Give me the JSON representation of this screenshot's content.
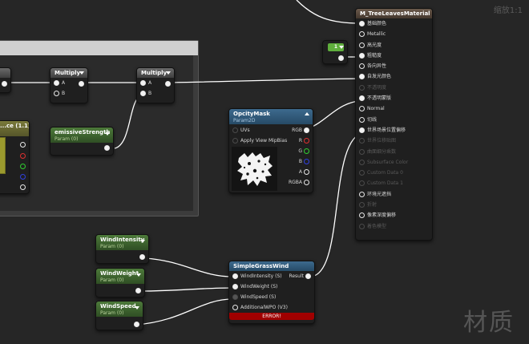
{
  "zoom_label": "缩放1:1",
  "watermark": "材质",
  "material_node": {
    "title": "M_TreeLeavesMaterial",
    "pins": [
      {
        "label": "基础颜色",
        "connected": true,
        "enabled": true
      },
      {
        "label": "Metallic",
        "connected": false,
        "enabled": true
      },
      {
        "label": "高光度",
        "connected": false,
        "enabled": true
      },
      {
        "label": "粗糙度",
        "connected": true,
        "enabled": true
      },
      {
        "label": "各向异性",
        "connected": false,
        "enabled": true
      },
      {
        "label": "自发光颜色",
        "connected": true,
        "enabled": true
      },
      {
        "label": "不透明度",
        "connected": false,
        "enabled": false
      },
      {
        "label": "不透明蒙版",
        "connected": true,
        "enabled": true
      },
      {
        "label": "Normal",
        "connected": false,
        "enabled": true
      },
      {
        "label": "切线",
        "connected": false,
        "enabled": true
      },
      {
        "label": "世界场景位置偏移",
        "connected": true,
        "enabled": true
      },
      {
        "label": "世界位移贴图",
        "connected": false,
        "enabled": false
      },
      {
        "label": "曲面细分乘数",
        "connected": false,
        "enabled": false
      },
      {
        "label": "Subsurface Color",
        "connected": false,
        "enabled": false
      },
      {
        "label": "Custom Data 0",
        "connected": false,
        "enabled": false
      },
      {
        "label": "Custom Data 1",
        "connected": false,
        "enabled": false
      },
      {
        "label": "环境光遮挡",
        "connected": false,
        "enabled": true
      },
      {
        "label": "折射",
        "connected": false,
        "enabled": false
      },
      {
        "label": "像素深度偏移",
        "connected": false,
        "enabled": true
      },
      {
        "label": "着色模型",
        "connected": false,
        "enabled": false
      }
    ]
  },
  "constant_node": {
    "value": "1"
  },
  "multiply1": {
    "title": "Multiply",
    "pin_a": "A",
    "pin_b": "B"
  },
  "multiply2": {
    "title": "Multiply",
    "pin_a": "A",
    "pin_b": "B"
  },
  "left_param": {
    "title": "...ce (1.1)"
  },
  "emissive_param": {
    "title": "emissiveStrength",
    "subtitle": "Param (0)"
  },
  "opacity_mask": {
    "title": "OpcityMask",
    "subtitle": "Param2D",
    "inputs": [
      "UVs",
      "Apply View MipBias"
    ],
    "outputs": [
      "RGB",
      "R",
      "G",
      "B",
      "A",
      "RGBA"
    ]
  },
  "wind_intensity": {
    "title": "WindIntensity",
    "subtitle": "Param (0)"
  },
  "wind_weight": {
    "title": "WindWeight",
    "subtitle": "Param (0)"
  },
  "wind_speed": {
    "title": "WindSpeed",
    "subtitle": "Param (0)"
  },
  "grass_wind": {
    "title": "SimpleGrassWind",
    "inputs": [
      "WindIntensity (S)",
      "WindWeight (S)",
      "WindSpeed (S)",
      "AdditionalWPO (V3)"
    ],
    "output": "Result",
    "error": "ERROR!"
  },
  "colors": {
    "background": "#262626",
    "wire": "#ffffff",
    "error": "#a00000",
    "param_header": "#4d7a3a",
    "texture_header": "#3d6a8e"
  }
}
